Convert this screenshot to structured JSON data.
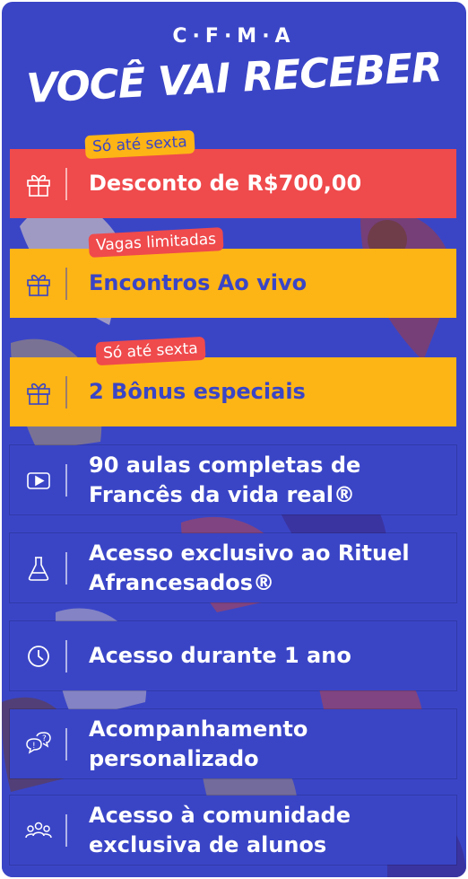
{
  "brand": "C·F·M·A",
  "headline": "VOCÊ VAI RECEBER",
  "colors": {
    "blue": "#3a45c6",
    "red": "#ef4a4c",
    "yellow": "#fdb515",
    "white": "#ffffff"
  },
  "items": [
    {
      "tag": "Só até sexta",
      "label": "Desconto de R$700,00",
      "icon": "gift-icon"
    },
    {
      "tag": "Vagas limitadas",
      "label": "Encontros Ao vivo",
      "icon": "gift-icon"
    },
    {
      "tag": "Só até sexta",
      "label": "2 Bônus especiais",
      "icon": "gift-icon"
    },
    {
      "label_line1": "90 aulas completas de",
      "label_line2": "Francês da vida real®",
      "icon": "video-play-icon"
    },
    {
      "label_line1": "Acesso exclusivo ao Rituel",
      "label_line2": "Afrancesados®",
      "icon": "flask-icon"
    },
    {
      "label": "Acesso durante 1 ano",
      "icon": "clock-icon"
    },
    {
      "label_line1": "Acompanhamento",
      "label_line2": "personalizado",
      "icon": "chat-question-icon"
    },
    {
      "label_line1": "Acesso à comunidade",
      "label_line2": "exclusiva de alunos",
      "icon": "community-icon"
    }
  ]
}
